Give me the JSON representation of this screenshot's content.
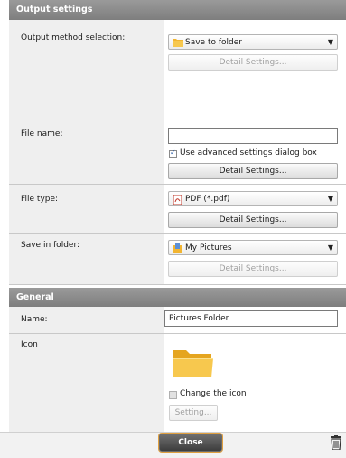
{
  "output_settings": {
    "header": "Output settings",
    "method": {
      "label": "Output method selection:",
      "value": "Save to folder",
      "icon": "folder-icon",
      "detail_button": "Detail Settings..."
    },
    "file_name": {
      "label": "File name:",
      "value": "",
      "advanced_checkbox": "Use advanced settings dialog box",
      "advanced_checked": true,
      "detail_button": "Detail Settings..."
    },
    "file_type": {
      "label": "File type:",
      "value": "PDF (*.pdf)",
      "icon": "pdf-icon",
      "detail_button": "Detail Settings..."
    },
    "save_in_folder": {
      "label": "Save in folder:",
      "value": "My Pictures",
      "icon": "pictures-folder-icon",
      "detail_button": "Detail Settings..."
    }
  },
  "general": {
    "header": "General",
    "name_label": "Name:",
    "name_value": "Pictures Folder",
    "icon_label": "Icon",
    "change_icon_label": "Change the icon",
    "change_icon_checked": false,
    "setting_button": "Setting..."
  },
  "footer": {
    "close_button": "Close",
    "trash": "trash-icon"
  },
  "colors": {
    "header_bg": "#8a8a8a",
    "label_col_bg": "#efefef",
    "close_btn_bg": "#4a4a4a",
    "close_btn_ring": "#e0a040",
    "folder_yellow": "#f2b531"
  }
}
